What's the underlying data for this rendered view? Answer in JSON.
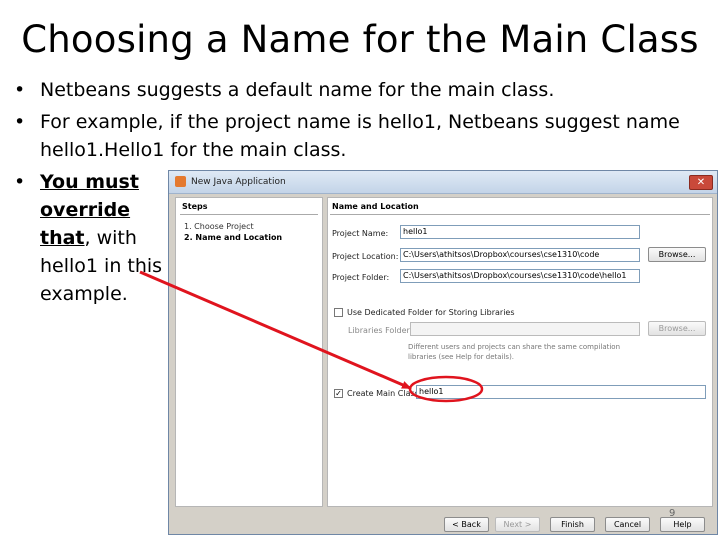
{
  "slide": {
    "title": "Choosing a Name for the Main Class",
    "bullet_glyph": "•",
    "bullets": [
      "Netbeans suggests a default name for the main class.",
      "For example, if the project name is hello1, Netbeans suggest name hello1.Hello1 for the main class."
    ],
    "bullet3": {
      "emph": "You must override that",
      "rest": ", with hello1 in this example."
    },
    "page_number": "9"
  },
  "dialog": {
    "title": "New Java Application",
    "close_label": "✕",
    "steps_heading": "Steps",
    "steps": [
      "1.   Choose Project",
      "2.   Name and Location"
    ],
    "section_heading": "Name and Location",
    "project_name_label": "Project Name:",
    "project_name_value": "hello1",
    "project_location_label": "Project Location:",
    "project_location_value": "C:\\Users\\athitsos\\Dropbox\\courses\\cse1310\\code",
    "browse_label": "Browse...",
    "project_folder_label": "Project Folder:",
    "project_folder_value": "C:\\Users\\athitsos\\Dropbox\\courses\\cse1310\\code\\hello1",
    "dedicated_folder_label": "Use Dedicated Folder for Storing Libraries",
    "libraries_folder_label": "Libraries Folder:",
    "libraries_note_1": "Different users and projects can share the same compilation",
    "libraries_note_2": "libraries (see Help for details).",
    "create_main_class_label": "Create Main Class",
    "create_main_class_checked": "✓",
    "main_class_value": "hello1",
    "buttons": {
      "back": "< Back",
      "next": "Next >",
      "finish": "Finish",
      "cancel": "Cancel",
      "help": "Help"
    }
  },
  "colors": {
    "annotation": "#e0141e"
  }
}
